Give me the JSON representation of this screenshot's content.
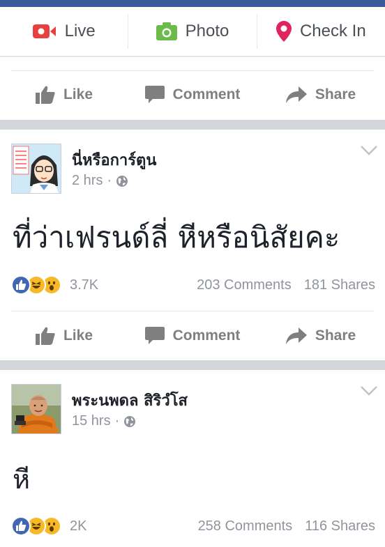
{
  "composer": {
    "live_label": "Live",
    "photo_label": "Photo",
    "checkin_label": "Check In"
  },
  "actions": {
    "like_label": "Like",
    "comment_label": "Comment",
    "share_label": "Share"
  },
  "posts": [
    {
      "author": "นี่หรือการ์ตูน",
      "time": "2 hrs",
      "text": "ที่ว่าเฟรนด์ลี่ หีหรือนิสัยคะ",
      "reactions_count": "3.7K",
      "comments": "203 Comments",
      "shares": "181 Shares"
    },
    {
      "author": "พระนพดล สิริวํโส",
      "time": "15 hrs",
      "text": "หี",
      "reactions_count": "2K",
      "comments": "258 Comments",
      "shares": "116 Shares"
    }
  ],
  "colors": {
    "brand": "#3b5998",
    "live_red": "#e9403f",
    "photo_green": "#6bba4a",
    "checkin_pink": "#e0245e",
    "like_blue": "#4267b2",
    "reaction_yellow": "#f7b928"
  },
  "icons": [
    "live-video-icon",
    "camera-icon",
    "location-pin-icon",
    "thumbs-up-icon",
    "comment-bubble-icon",
    "share-arrow-icon",
    "globe-icon",
    "chevron-down-icon"
  ]
}
